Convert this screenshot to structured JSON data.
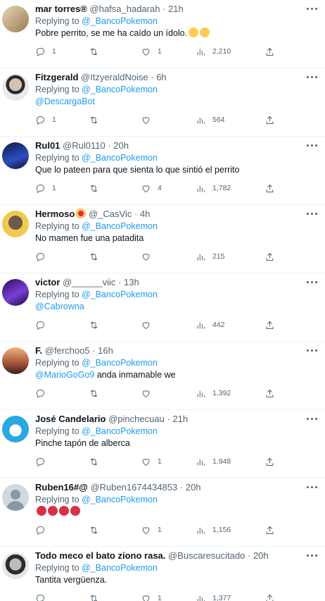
{
  "reply_to": "@_BancoPokemon",
  "replying_prefix": "Replying to ",
  "tweets": [
    {
      "name": "mar torres®",
      "handle": "@hafsa_hadarah",
      "time": "21h",
      "text": "Pobre perrito,  se me ha caído un ídolo.",
      "replies": "1",
      "retweets": "",
      "likes": "1",
      "views": "2,210",
      "avatar_color": "#c9b48f"
    },
    {
      "name": "Fitzgerald",
      "handle": "@ItzyeraldNoise",
      "time": "6h",
      "mention": "@DescargaBot",
      "replies": "1",
      "retweets": "",
      "likes": "",
      "views": "564",
      "avatar_color": "#6e6e6e"
    },
    {
      "name": "Rul01",
      "handle": "@Rul0110",
      "time": "20h",
      "text": "Que lo pateen para que sienta lo que sintió el perrito",
      "replies": "1",
      "retweets": "",
      "likes": "4",
      "views": "1,782",
      "avatar_color": "#1b2a6b"
    },
    {
      "name": "Hermoso",
      "handle": "@_CasVic",
      "time": "4h",
      "text": "No mamen fue una patadita",
      "replies": "",
      "retweets": "",
      "likes": "",
      "views": "215",
      "avatar_color": "#e8b84a"
    },
    {
      "name": "victor",
      "handle": "@______viic",
      "time": "13h",
      "mention": "@Cabrowna",
      "replies": "",
      "retweets": "",
      "likes": "",
      "views": "442",
      "avatar_color": "#5b2fa8"
    },
    {
      "name": "F.",
      "handle": "@ferchoo5",
      "time": "16h",
      "mention": "@MarioGoGo9",
      "text": " anda inmamable we",
      "replies": "",
      "retweets": "",
      "likes": "",
      "views": "1,392",
      "avatar_color": "#c46a3c"
    },
    {
      "name": "José Candelario",
      "handle": "@pinchecuau",
      "time": "21h",
      "text": "Pinche tapón de alberca",
      "replies": "",
      "retweets": "",
      "likes": "1",
      "views": "1,948",
      "avatar_color": "#2aa8e0"
    },
    {
      "name": "Ruben16#@",
      "handle": "@Ruben1674434853",
      "time": "20h",
      "replies": "",
      "retweets": "",
      "likes": "1",
      "views": "1,156",
      "avatar_color": "#cfd9de"
    },
    {
      "name": "Todo meco el bato ziono rasa.",
      "handle": "@Buscaresucitado",
      "time": "20h",
      "text": "Tantita vergüenza.",
      "replies": "",
      "retweets": "",
      "likes": "1",
      "views": "1,377",
      "avatar_color": "#3a3a3a"
    }
  ],
  "colors": {
    "link": "#1d9bf0",
    "muted": "#536471",
    "text": "#0f1419"
  }
}
